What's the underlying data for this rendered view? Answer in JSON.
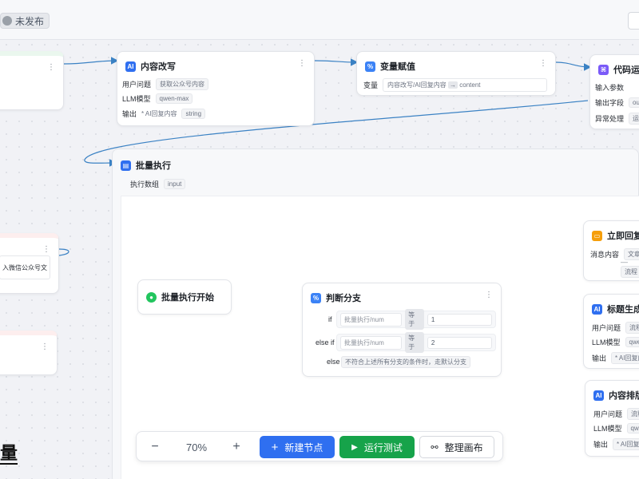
{
  "header": {
    "status_label": "未发布"
  },
  "nodes": {
    "content_rewrite": {
      "title": "内容改写",
      "icon": "ai-icon",
      "fields": {
        "user_question_label": "用户问题",
        "user_question_value": "获取公众号内容",
        "model_label": "LLM模型",
        "model_value": "qwen-max",
        "output_label": "输出",
        "output_name": "* AI回复内容",
        "output_type": "string"
      }
    },
    "variable_assign": {
      "title": "变量赋值",
      "icon": "assign-icon",
      "var_label": "变量",
      "var_source": "内容改写/AI回复内容",
      "var_target": "content"
    },
    "code_run": {
      "title": "代码运行",
      "icon": "code-icon",
      "input_label": "输入参数",
      "output_label": "输出字段",
      "output_value": "outp",
      "error_label": "异常处理",
      "error_value": "运行"
    },
    "left_input": {
      "text": "入微信公众号文章"
    },
    "batch": {
      "title": "批量执行",
      "array_label": "执行数组",
      "array_value": "input"
    },
    "batch_start": {
      "title": "批量执行开始"
    },
    "branch": {
      "title": "判断分支",
      "if_label": "if",
      "if_field": "批量执行/num",
      "if_op": "等于",
      "if_value": "1",
      "elseif_label": "else if",
      "elseif_field": "批量执行/num",
      "elseif_op": "等于",
      "elseif_value": "2",
      "else_label": "else",
      "else_text": "不符合上述所有分支的条件时，走默认分支"
    },
    "instant_reply": {
      "title": "立即回复",
      "msg_label": "消息内容",
      "msg_value": "文章(",
      "msg_value2": "—",
      "msg_value3": "流程"
    },
    "title_gen": {
      "title": "标题生成",
      "q_label": "用户问题",
      "q_value": "流程月",
      "model_label": "LLM模型",
      "model_value": "qwen",
      "output_label": "输出",
      "output_value": "* AI回复内"
    },
    "layout_node": {
      "title": "内容排版",
      "q_label": "用户问题",
      "q_value": "流程",
      "model_label": "LLM模型",
      "model_value": "qwen",
      "output_label": "输出",
      "output_value": "* AI回复内"
    }
  },
  "toolbar": {
    "zoom_out": "−",
    "zoom_level": "70%",
    "zoom_in": "+",
    "new_node": "新建节点",
    "run_test": "运行测试",
    "tidy_canvas": "整理画布"
  },
  "corner_glyph": "量",
  "colors": {
    "primary": "#2f6ff0",
    "success": "#16a34a",
    "wire": "#3b82c4"
  }
}
